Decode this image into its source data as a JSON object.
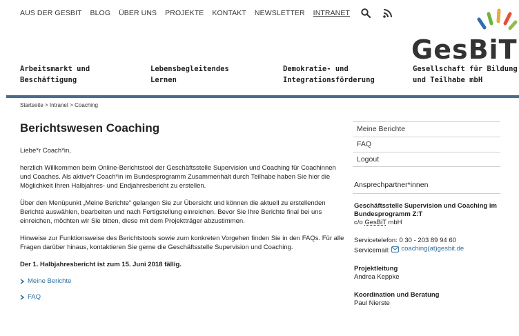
{
  "topnav": {
    "items": [
      "AUS DER GESBIT",
      "BLOG",
      "ÜBER UNS",
      "PROJEKTE",
      "KONTAKT",
      "NEWSLETTER",
      "INTRANET"
    ],
    "active": "INTRANET"
  },
  "logo": {
    "text": "GesBiT",
    "subtitle_line1": "Gesellschaft für Bildung",
    "subtitle_line2": "und Teilhabe mbH",
    "ray_colors": [
      "#2f6fb0",
      "#6cb33f",
      "#e9a93b",
      "#e64e3c",
      "#8fbf44"
    ]
  },
  "mainnav": {
    "items": [
      {
        "line1": "Arbeitsmarkt und",
        "line2": "Beschäftigung"
      },
      {
        "line1": "Lebensbegleitendes",
        "line2": "Lernen"
      },
      {
        "line1": "Demokratie- und",
        "line2": "Integrationsförderung"
      }
    ]
  },
  "breadcrumb": "Startseite > Intranet > Coaching",
  "main": {
    "title": "Berichtswesen Coaching",
    "greeting": "Liebe*r Coach*in,",
    "p1": "herzlich Willkommen beim Online-Berichtstool der Geschäftsstelle Supervision und Coaching für Coachinnen und Coaches. Als aktive*r Coach*in im Bundesprogramm Zusammenhalt durch Teilhabe haben Sie hier die Möglichkeit Ihren Halbjahres- und Endjahresbericht zu erstellen.",
    "p2": "Über den Menüpunkt „Meine Berichte“ gelangen Sie zur Übersicht und können die aktuell zu erstellenden Berichte auswählen, bearbeiten und nach Fertigstellung einreichen. Bevor Sie Ihre Berichte final bei uns einreichen, möchten wir Sie bitten, diese mit dem Projektträger abzustimmen.",
    "p3": "Hinweise zur Funktionsweise des Berichtstools sowie zum konkreten Vorgehen finden Sie in den FAQs. Für alle Fragen darüber hinaus, kontaktieren Sie gerne die Geschäftsstelle Supervision und Coaching.",
    "deadline": "Der 1. Halbjahresbericht ist zum 15. Juni 2018 fällig.",
    "links": [
      "Meine Berichte",
      "FAQ"
    ]
  },
  "sidebar": {
    "menu": [
      "Meine Berichte",
      "FAQ",
      "Logout"
    ],
    "contact_heading": "Ansprechpartner*innen",
    "org_line1": "Geschäftsstelle Supervision und Coaching im",
    "org_line2": "Bundesprogramm Z:T",
    "org_line3_prefix": "c/o ",
    "org_line3_abbr": "GesBiT",
    "org_line3_suffix": " mbH",
    "phone": "Servicetelefon: 0 30 - 203 89 94 60",
    "email_label": "Servicemail: ",
    "email": "coaching(at)gesbit.de",
    "lead_label": "Projektleitung",
    "lead_name": "Andrea Keppke",
    "coord_label": "Koordination und Beratung",
    "coord_name": "Paul Nierste"
  },
  "colors": {
    "accent_bar": "#4a6d8c",
    "link": "#2f6f9f"
  }
}
